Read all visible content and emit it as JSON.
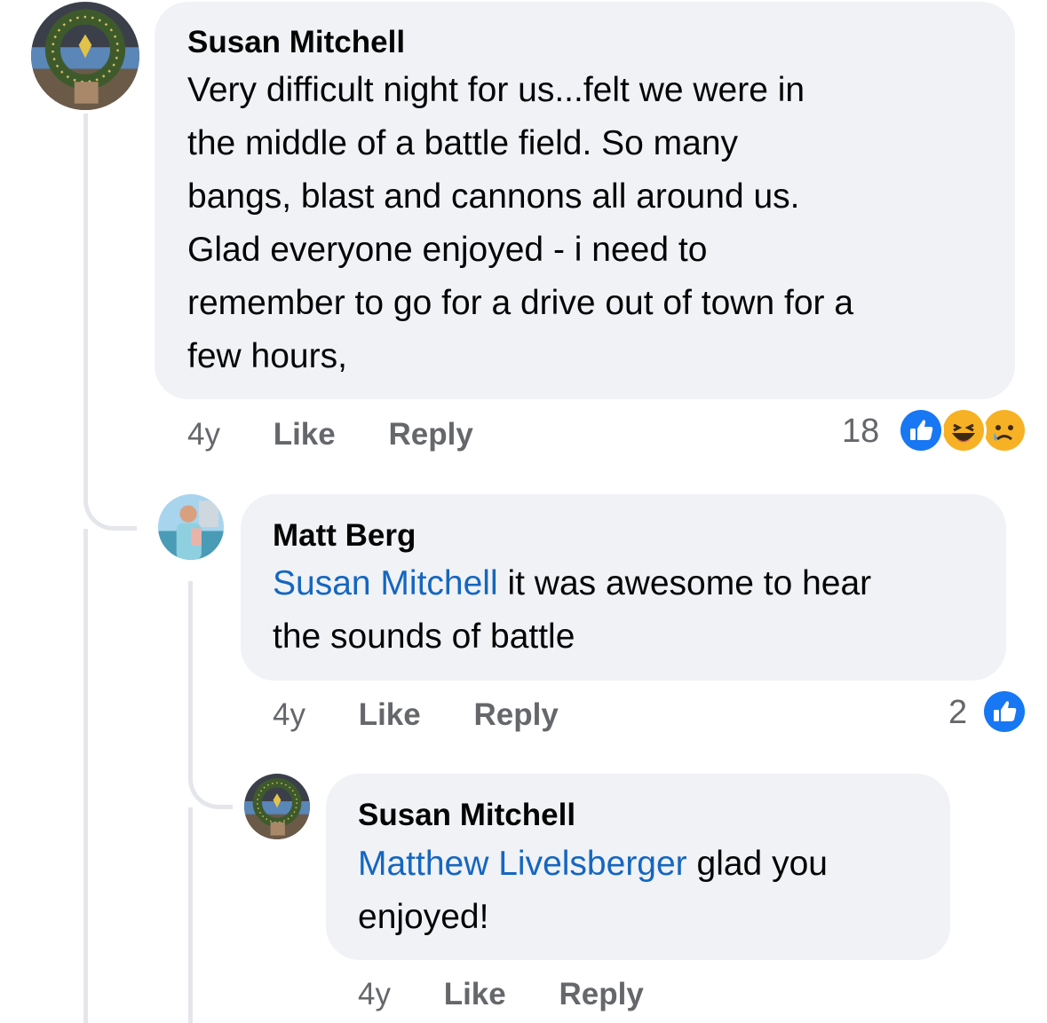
{
  "comments": [
    {
      "author": "Susan Mitchell",
      "text_lines": [
        "Very difficult night for us...felt we were in",
        "the middle of a battle field.  So many",
        "bangs, blast and cannons all around us.",
        "Glad everyone enjoyed - i need to",
        "remember to go for a drive out of town for a",
        "few hours,"
      ],
      "time": "4y",
      "like_label": "Like",
      "reply_label": "Reply",
      "reaction_count": "18",
      "reactions": [
        "like-icon",
        "haha-icon",
        "sad-icon"
      ]
    },
    {
      "author": "Matt Berg",
      "mention": "Susan Mitchell",
      "text_line1_rest": " it was awesome to hear",
      "text_line2": "the sounds of battle",
      "time": "4y",
      "like_label": "Like",
      "reply_label": "Reply",
      "reaction_count": "2",
      "reactions": [
        "like-icon"
      ]
    },
    {
      "author": "Susan Mitchell",
      "mention": "Matthew Livelsberger",
      "text_line1_rest": " glad you",
      "text_line2": "enjoyed!",
      "time": "4y",
      "like_label": "Like",
      "reply_label": "Reply"
    }
  ],
  "colors": {
    "bubble": "#f0f2f5",
    "mention": "#1566c0",
    "meta": "#65676b",
    "like_blue": "#1877f2",
    "thread_line": "#e4e6eb"
  }
}
